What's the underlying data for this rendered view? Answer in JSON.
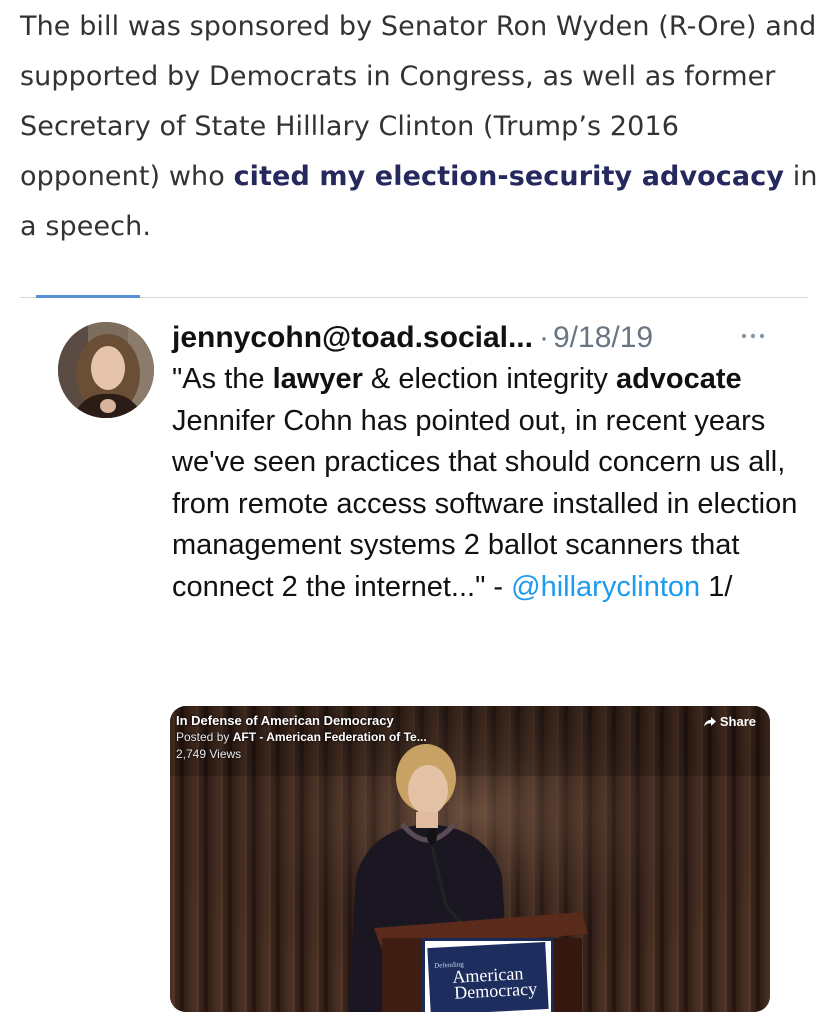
{
  "article": {
    "text_before_link": "The bill was sponsored by Senator Ron Wyden (R-Ore) and supported by Democrats in Congress, as well as former Secretary of State Hilllary Clinton (Trump’s 2016 opponent) who ",
    "link_text": "cited my election-security advocacy",
    "text_after_link": " in a speech."
  },
  "tweet": {
    "handle": "jennycohn@toad.social...",
    "separator": "·",
    "date": "9/18/19",
    "body": {
      "part1": "\"As the ",
      "bold1": "lawyer",
      "part2": " & election integrity ",
      "bold2": "advocate",
      "part3": " Jennifer Cohn has pointed out, in recent years we've seen practices that should concern us all, from remote access software installed in election management systems 2 ballot scanners that connect 2 the internet...\" - ",
      "mention": "@hillaryclinton",
      "part4": " 1/"
    }
  },
  "video": {
    "title": "In Defense of American Democracy",
    "posted_prefix": "Posted by ",
    "posted_by": "AFT - American Federation of Te...",
    "views": "2,749 Views",
    "share_label": "Share",
    "podium_small": "Defending",
    "podium_line1": "American",
    "podium_line2": "Democracy"
  },
  "colors": {
    "link": "#26295e",
    "mention": "#1d9bf0",
    "divider_accent": "#5b8fd4"
  }
}
